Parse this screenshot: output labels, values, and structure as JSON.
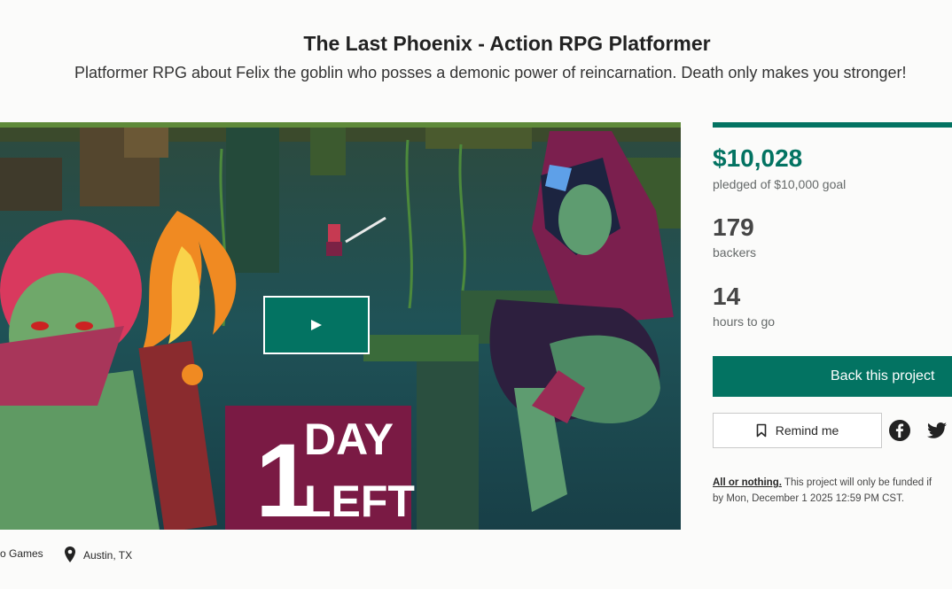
{
  "project": {
    "title": "The Last Phoenix - Action RPG Platformer",
    "subtitle": "Platformer RPG about Felix the goblin who posses a demonic power of reincarnation. Death only makes you stronger!"
  },
  "video": {
    "overlay_number": "1",
    "overlay_line1": "DAY",
    "overlay_line2": "LEFT",
    "play_icon": "play-icon"
  },
  "campaign": {
    "funding_progress": 1.0,
    "pledged": "$10,028",
    "pledged_label": "pledged of $10,000 goal",
    "backers": "179",
    "backers_label": "backers",
    "time_left": "14",
    "time_left_label": "hours to go",
    "back_button": "Back this project",
    "remind_button": "Remind me",
    "share_icons": [
      "facebook-icon",
      "twitter-icon"
    ],
    "aon_link": "All or nothing.",
    "aon_text": " This project will only be funded if",
    "deadline_text": "by Mon, December 1 2025 12:59 PM CST."
  },
  "meta": {
    "creator": "o Games",
    "location": "Austin, TX"
  },
  "colors": {
    "accent": "#037362",
    "pledge_text": "#037362",
    "overlay_box": "#7a1a44"
  }
}
